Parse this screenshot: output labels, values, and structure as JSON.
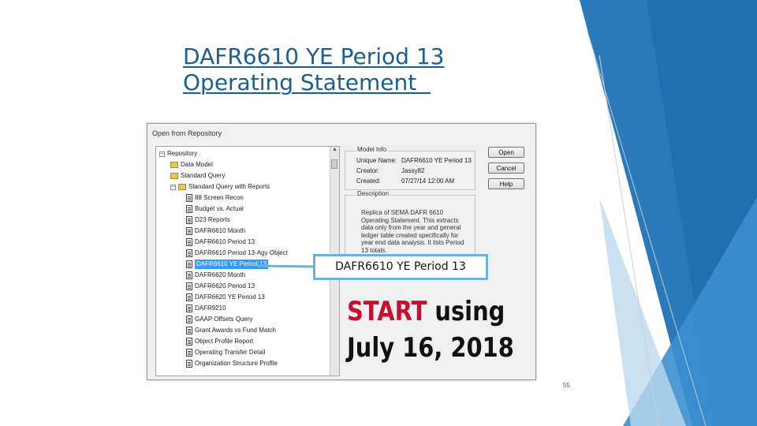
{
  "slide": {
    "title_line1": "DAFR6610 YE Period 13",
    "title_line2": "Operating Statement  ",
    "page_number": "55",
    "colors": {
      "title": "#1b5f8e",
      "accent_blue": "#2a7ab9",
      "highlight_red": "#c8102e"
    }
  },
  "dialog": {
    "title": "Open from Repository",
    "tree": {
      "root": "Repository",
      "folders": [
        "Data Model",
        "Standard Query",
        "Standard Query with Reports"
      ],
      "reports": [
        "88 Screen Recon",
        "Budget vs. Actual",
        "D23 Reports",
        "DAFR6610 Month",
        "DAFR6610 Period 13",
        "DAFR6610 Period 13-Agy Object",
        "DAFR6610 YE Period 13",
        "DAFR6620 Month",
        "DAFR6620 Period 13",
        "DAFR6620 YE Period 13",
        "DAFR9210",
        "GAAP Offsets Query",
        "Grant Awards vs Fund Match",
        "Object Profile Report",
        "Operating Transfer Detail",
        "Organization Structure Profile"
      ],
      "selected": "DAFR6610 YE Period 13"
    },
    "model_info": {
      "legend": "Model Info",
      "unique_name_label": "Unique Name:",
      "unique_name_value": "DAFR6610 YE Period 13",
      "creator_label": "Creator:",
      "creator_value": "Jassy82",
      "created_label": "Created:",
      "created_value": "07/27/14 12:00 AM"
    },
    "description": {
      "legend": "Description",
      "text": "Replica of SEMA DAFR 6610 Operating Statement. This extracts data only from the year and general ledger table created specifically for year end data analysis. It lists Period 13 totals."
    },
    "buttons": {
      "open": "Open",
      "cancel": "Cancel",
      "help": "Help"
    }
  },
  "callout": {
    "text": "DAFR6610 YE Period 13"
  },
  "start_note": {
    "word1": "START",
    "word2": "using",
    "line2": "July 16, 2018"
  }
}
